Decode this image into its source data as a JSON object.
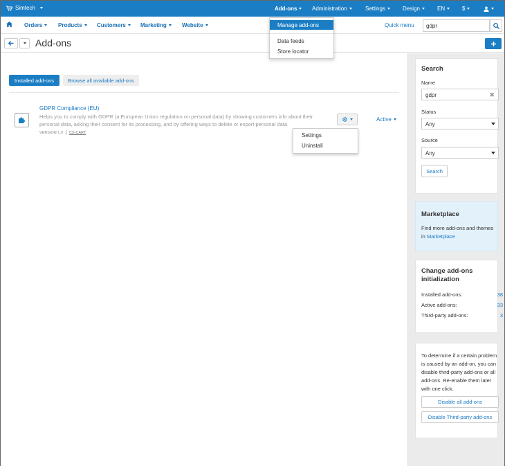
{
  "topbar": {
    "brand": "Simtech",
    "menus": [
      {
        "label": "Add-ons",
        "active": true
      },
      {
        "label": "Administration"
      },
      {
        "label": "Settings"
      },
      {
        "label": "Design"
      },
      {
        "label": "EN"
      },
      {
        "label": "$"
      }
    ],
    "addons_dropdown": {
      "items": [
        "Manage add-ons",
        "Data feeds",
        "Store locator"
      ]
    }
  },
  "nav": {
    "items": [
      "Orders",
      "Products",
      "Customers",
      "Marketing",
      "Website"
    ],
    "quick_menu": "Quick menu",
    "search_value": "gdpr"
  },
  "page": {
    "title": "Add-ons",
    "tabs": [
      "Installed add-ons",
      "Browse all available add-ons"
    ]
  },
  "addon": {
    "name": "GDPR Compliance (EU)",
    "description": "Helps you to comply with GDPR (a European Union regulation on personal data) by showing customers info about their personal data, asking their consent for its processing, and by offering ways to delete or export personal data.",
    "version": "VERSION 1.0",
    "vendor": "CS-CART",
    "status": "Active",
    "actions": [
      "Settings",
      "Uninstall"
    ]
  },
  "sidebar": {
    "search": {
      "title": "Search",
      "name_label": "Name",
      "name_value": "gdpr",
      "status_label": "Status",
      "status_value": "Any",
      "source_label": "Source",
      "source_value": "Any",
      "button": "Search"
    },
    "marketplace": {
      "title": "Marketplace",
      "text": "Find more add-ons and themes in",
      "link": "Marketplace"
    },
    "init": {
      "title": "Change add-ons initialization",
      "rows": [
        {
          "label": "Installed add-ons:",
          "value": "38"
        },
        {
          "label": "Active add-ons:",
          "value": "33"
        },
        {
          "label": "Third-party add-ons:",
          "value": "3"
        }
      ]
    },
    "disable": {
      "text": "To determine if a certain problem is caused by an add-on, you can disable third-party add-ons or all add-ons. Re-enable them later with one click.",
      "buttons": [
        "Disable all add-ons",
        "Disable Third-party add-ons"
      ]
    }
  },
  "colors": {
    "brand": "#1b7ec4",
    "link": "#1a7ac5",
    "sidebar_bg": "#ebebeb",
    "marketplace_bg": "#e3f1fb"
  }
}
